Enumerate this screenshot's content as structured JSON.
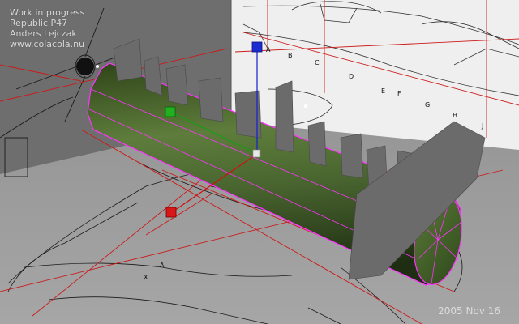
{
  "overlay": {
    "line1": "Work in progress",
    "line2": "Republic P47",
    "line3": "Anders Lejczak",
    "line4": "www.colacola.nu"
  },
  "date": "2005 Nov 16",
  "blueprint_letters": [
    "A",
    "B",
    "C",
    "D",
    "E",
    "F",
    "G",
    "H",
    "J"
  ],
  "ground_letters": [
    "A",
    "X"
  ],
  "colors": {
    "x_axis_handle": "#d01010",
    "y_axis_handle": "#10a010",
    "z_axis_handle": "#1020d0",
    "selection": "#ff33ff",
    "reference_lines": "#d01818",
    "fuselage": "#4d6a30"
  },
  "icons": [
    "move-gizmo-icon",
    "pivot-icon"
  ]
}
